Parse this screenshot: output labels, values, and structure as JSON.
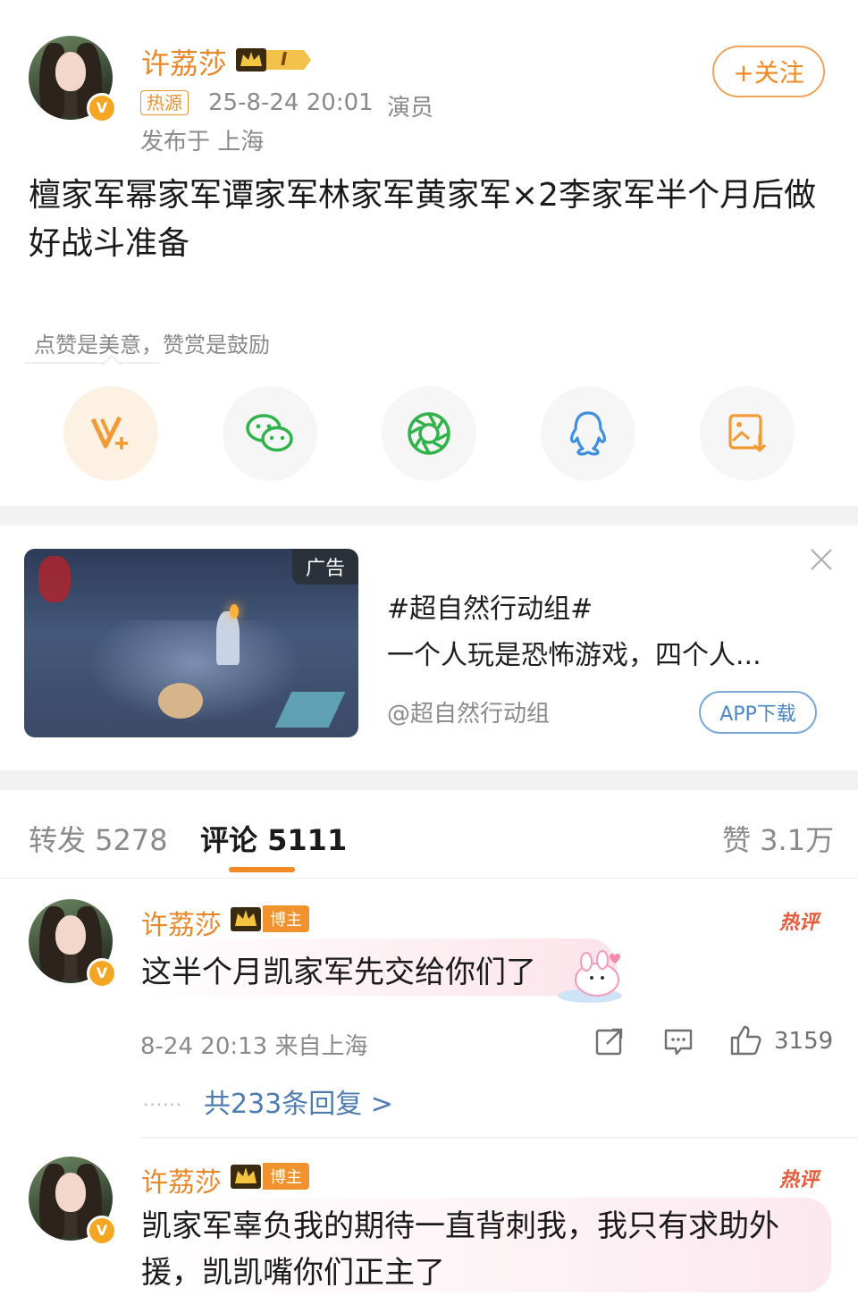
{
  "post": {
    "author": "许荔莎",
    "level_badge": "I",
    "source_tag": "热源",
    "datetime": "25-8-24 20:01",
    "role": "演员",
    "location": "发布于 上海",
    "follow_label": "+关注",
    "content": "檀家军幂家军谭家军林家军黄家军×2李家军半个月后做好战斗准备",
    "tip_text": "点赞是美意，赞赏是鼓励",
    "share_icons": [
      "reward-icon",
      "wechat-icon",
      "moments-icon",
      "qq-icon",
      "save-image-icon"
    ]
  },
  "ad": {
    "tag": "广告",
    "title": "#超自然行动组#",
    "desc": "一个人玩是恐怖游戏，四个人...",
    "account": "@超自然行动组",
    "button": "APP下载",
    "close_icon": "close-icon"
  },
  "stats": {
    "repost": "转发 5278",
    "comment": "评论 5111",
    "like": "赞 3.1万"
  },
  "comments": [
    {
      "author": "许荔莎",
      "badge": "博主",
      "hot": "热评",
      "text": "这半个月凯家军先交给你们了",
      "meta": "8-24 20:13 来自上海",
      "likes": "3159",
      "replies": "共233条回复 >"
    },
    {
      "author": "许荔莎",
      "badge": "博主",
      "hot": "热评",
      "text": "凯家军辜负我的期待一直背刺我，我只有求助外援，凯凯嘴你们正主了"
    }
  ],
  "colors": {
    "accent": "#f08a24",
    "link": "#4f7cb0",
    "hot": "#e85b3a"
  }
}
